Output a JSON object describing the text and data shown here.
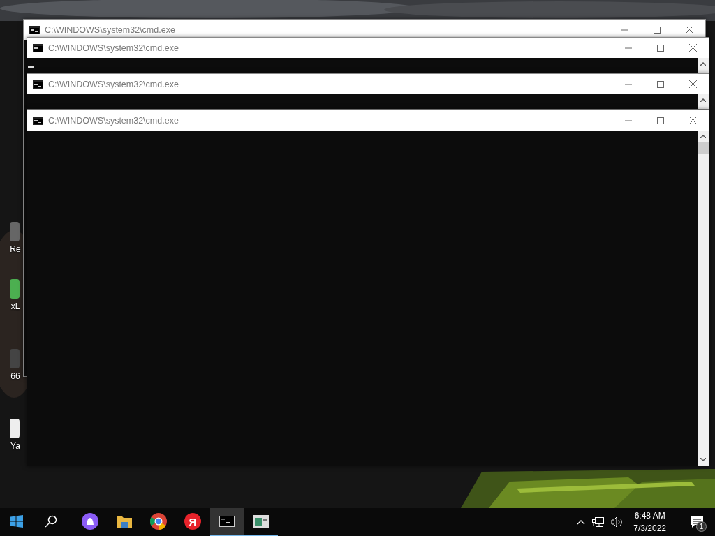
{
  "desktop_icons": [
    {
      "label": "Re"
    },
    {
      "label": "xL"
    },
    {
      "label": "66"
    },
    {
      "label": "Ya"
    }
  ],
  "windows": [
    {
      "title": "C:\\WINDOWS\\system32\\cmd.exe",
      "cursor": false
    },
    {
      "title": "C:\\WINDOWS\\system32\\cmd.exe",
      "cursor": true
    },
    {
      "title": "C:\\WINDOWS\\system32\\cmd.exe",
      "cursor": false
    },
    {
      "title": "C:\\WINDOWS\\system32\\cmd.exe",
      "cursor": false
    }
  ],
  "taskbar": {
    "apps": [
      {
        "kind": "assistant",
        "running": false,
        "selected": false
      },
      {
        "kind": "folder",
        "running": false,
        "selected": false
      },
      {
        "kind": "browser",
        "running": false,
        "selected": false
      },
      {
        "kind": "letter",
        "label": "Я",
        "running": false,
        "selected": false
      },
      {
        "kind": "terminal",
        "running": true,
        "selected": true
      },
      {
        "kind": "window",
        "running": true,
        "selected": false
      }
    ],
    "clock": {
      "time": "6:48 AM",
      "date": "7/3/2022"
    },
    "notification_count": "1"
  }
}
